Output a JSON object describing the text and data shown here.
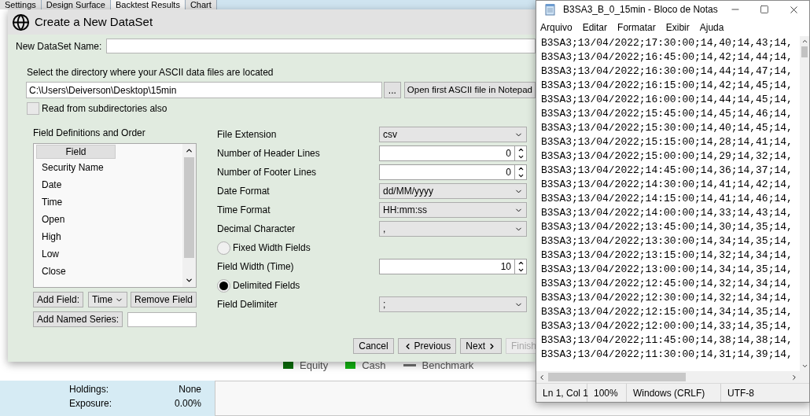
{
  "app": {
    "tabs": [
      {
        "label": "Settings",
        "selected": false
      },
      {
        "label": "Design Surface",
        "selected": false
      },
      {
        "label": "Backtest Results",
        "selected": true
      },
      {
        "label": "Chart",
        "selected": false
      }
    ],
    "legend": [
      {
        "label": "Equity",
        "kind": "box",
        "color": "#0a6e0a"
      },
      {
        "label": "Cash",
        "kind": "box",
        "color": "#12b312"
      },
      {
        "label": "Benchmark",
        "kind": "line",
        "color": "#707070"
      }
    ],
    "stats": [
      {
        "label": "Holdings:",
        "value": "None"
      },
      {
        "label": "Exposure:",
        "value": "0.00%"
      }
    ]
  },
  "dialog": {
    "title": "Create a New DataSet",
    "name_label": "New DataSet Name:",
    "directory_label": "Select the directory where your ASCII data files are located",
    "directory_value": "C:\\Users\\Deiverson\\Desktop\\15min",
    "browse_button": "...",
    "open_button": "Open first ASCII file in Notepad",
    "subdirs": {
      "label": "Read from subdirectories also",
      "checked": false
    },
    "fields_title": "Field Definitions and Order",
    "fields_column": "Field",
    "fields": [
      "Security Name",
      "Date",
      "Time",
      "Open",
      "High",
      "Low",
      "Close"
    ],
    "add_field_button": "Add Field:",
    "add_field_type": "Time",
    "remove_field_button": "Remove Field",
    "add_series_button": "Add Named Series:",
    "settings": [
      {
        "kind": "select",
        "label": "File Extension",
        "value": "csv"
      },
      {
        "kind": "spin",
        "label": "Number of Header Lines",
        "value": "0"
      },
      {
        "kind": "spin",
        "label": "Number of Footer Lines",
        "value": "0"
      },
      {
        "kind": "select",
        "label": "Date Format",
        "value": "dd/MM/yyyy"
      },
      {
        "kind": "select",
        "label": "Time Format",
        "value": "HH:mm:ss"
      },
      {
        "kind": "select",
        "label": "Decimal Character",
        "value": ","
      },
      {
        "kind": "radio",
        "label": "Fixed Width Fields",
        "selected": false
      },
      {
        "kind": "spin",
        "label": "Field Width (Time)",
        "value": "10"
      },
      {
        "kind": "radio",
        "label": "Delimited Fields",
        "selected": true
      },
      {
        "kind": "select",
        "label": "Field Delimiter",
        "value": ";"
      }
    ],
    "buttons": [
      {
        "label": "Cancel",
        "kind": "plain",
        "disabled": false
      },
      {
        "label": "Previous",
        "kind": "back",
        "disabled": false
      },
      {
        "label": "Next",
        "kind": "forward",
        "disabled": false
      },
      {
        "label": "Finish",
        "kind": "plain",
        "disabled": true
      }
    ]
  },
  "notepad": {
    "title": "B3SA3_B_0_15min - Bloco de Notas",
    "menu": [
      "Arquivo",
      "Editar",
      "Formatar",
      "Exibir",
      "Ajuda"
    ],
    "lines": [
      "B3SA3;13/04/2022;17:30:00;14,40;14,43;14,",
      "B3SA3;13/04/2022;16:45:00;14,42;14,44;14,",
      "B3SA3;13/04/2022;16:30:00;14,44;14,47;14,",
      "B3SA3;13/04/2022;16:15:00;14,42;14,45;14,",
      "B3SA3;13/04/2022;16:00:00;14,44;14,45;14,",
      "B3SA3;13/04/2022;15:45:00;14,45;14,46;14,",
      "B3SA3;13/04/2022;15:30:00;14,40;14,45;14,",
      "B3SA3;13/04/2022;15:15:00;14,28;14,41;14,",
      "B3SA3;13/04/2022;15:00:00;14,29;14,32;14,",
      "B3SA3;13/04/2022;14:45:00;14,36;14,37;14,",
      "B3SA3;13/04/2022;14:30:00;14,41;14,42;14,",
      "B3SA3;13/04/2022;14:15:00;14,41;14,46;14,",
      "B3SA3;13/04/2022;14:00:00;14,33;14,43;14,",
      "B3SA3;13/04/2022;13:45:00;14,30;14,35;14,",
      "B3SA3;13/04/2022;13:30:00;14,34;14,35;14,",
      "B3SA3;13/04/2022;13:15:00;14,32;14,34;14,",
      "B3SA3;13/04/2022;13:00:00;14,34;14,35;14,",
      "B3SA3;13/04/2022;12:45:00;14,32;14,34;14,",
      "B3SA3;13/04/2022;12:30:00;14,32;14,34;14,",
      "B3SA3;13/04/2022;12:15:00;14,34;14,35;14,",
      "B3SA3;13/04/2022;12:00:00;14,33;14,35;14,",
      "B3SA3;13/04/2022;11:45:00;14,38;14,38;14,",
      "B3SA3;13/04/2022;11:30:00;14,31;14,39;14,"
    ],
    "status": [
      "Ln 1, Col 1",
      "100%",
      "Windows (CRLF)",
      "UTF-8"
    ]
  }
}
